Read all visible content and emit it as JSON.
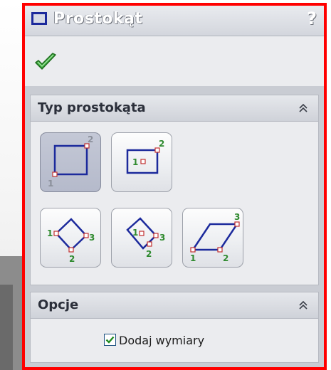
{
  "panel": {
    "title": "Prostokąt",
    "help": "?",
    "icons": {
      "title": "rectangle-icon",
      "ok": "checkmark-icon",
      "help": "help-icon"
    }
  },
  "type_group": {
    "title": "Typ prostokąta",
    "buttons": [
      {
        "name": "corner-rectangle",
        "points": [
          "1",
          "2"
        ],
        "selected": true
      },
      {
        "name": "center-rectangle",
        "points": [
          "1",
          "2"
        ],
        "selected": false
      },
      {
        "name": "3-point-corner-rectangle",
        "points": [
          "1",
          "2",
          "3"
        ],
        "selected": false
      },
      {
        "name": "3-point-center-rectangle",
        "points": [
          "1",
          "2",
          "3"
        ],
        "selected": false
      },
      {
        "name": "parallelogram",
        "points": [
          "1",
          "2",
          "3"
        ],
        "selected": false
      }
    ]
  },
  "options_group": {
    "title": "Opcje",
    "checkbox_label": "Dodaj wymiary",
    "checked": true
  },
  "colors": {
    "frame": "#ff0000",
    "shape": "#1c2a9c",
    "point_number": "#2f8a2f"
  }
}
